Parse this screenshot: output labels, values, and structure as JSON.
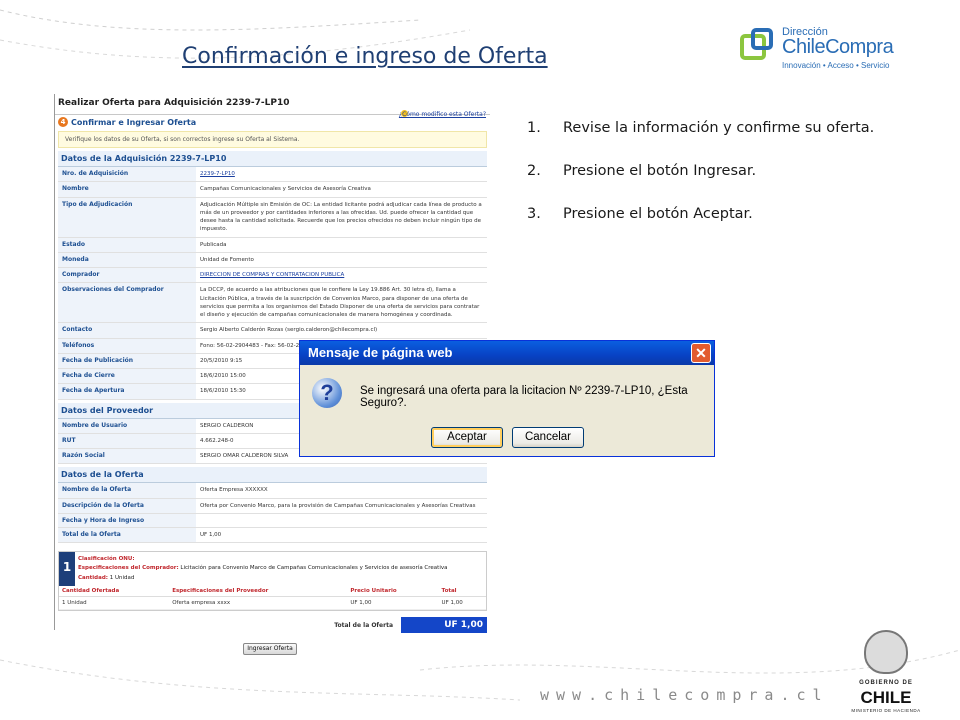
{
  "title": "Confirmación e ingreso de Oferta",
  "logo": {
    "dir": "Dirección",
    "name": "ChileCompra",
    "tagline": "Innovación • Acceso • Servicio"
  },
  "portal": {
    "header": "Realizar Oferta para Adquisición 2239-7-LP10",
    "help_link": "¿Cómo modifico esta Oferta?",
    "step_number": "4",
    "step_label": "Confirmar e Ingresar Oferta",
    "note": "Verifique los datos de su Oferta, si son correctos ingrese su Oferta al Sistema.",
    "sections": [
      {
        "title": "Datos de la Adquisición 2239-7-LP10",
        "rows": [
          {
            "k": "Nro. de Adquisición",
            "v": "2239-7-LP10",
            "link": true
          },
          {
            "k": "Nombre",
            "v": "Campañas Comunicacionales y Servicios de Asesoría Creativa"
          },
          {
            "k": "Tipo de Adjudicación",
            "v": "Adjudicación Múltiple sin Emisión de OC: La entidad licitante podrá adjudicar cada línea de producto a más de un proveedor y por cantidades inferiores a las ofrecidas. Ud. puede ofrecer la cantidad que desee hasta la cantidad solicitada. Recuerde que los precios ofrecidos no deben incluir ningún tipo de impuesto."
          },
          {
            "k": "Estado",
            "v": "Publicada"
          },
          {
            "k": "Moneda",
            "v": "Unidad de Fomento"
          },
          {
            "k": "Comprador",
            "v": "DIRECCION DE COMPRAS Y CONTRATACION PUBLICA",
            "link": true
          },
          {
            "k": "Observaciones del Comprador",
            "v": "La DCCP, de acuerdo a las atribuciones que le confiere la Ley 19.886 Art. 30 letra d), llama a Licitación Pública, a través de la suscripción de Convenios Marco, para disponer de una oferta de servicios que permita a los organismos del Estado Disponer de una oferta de servicios para contratar el diseño y ejecución de campañas comunicacionales de manera homogénea y coordinada."
          },
          {
            "k": "Contacto",
            "v": "Sergio Alberto Calderón Rozas (sergio.calderon@chilecompra.cl)"
          },
          {
            "k": "Teléfonos",
            "v": "Fono: 56-02-2904483 - Fax: 56-02-2904488"
          },
          {
            "k": "Fecha de Publicación",
            "v": "20/5/2010 9:15"
          },
          {
            "k": "Fecha de Cierre",
            "v": "18/6/2010 15:00"
          },
          {
            "k": "Fecha de Apertura",
            "v": "18/6/2010 15:30"
          }
        ]
      },
      {
        "title": "Datos del Proveedor",
        "rows": [
          {
            "k": "Nombre de Usuario",
            "v": "SERGIO CALDERON"
          },
          {
            "k": "RUT",
            "v": "4.662.248-0"
          },
          {
            "k": "Razón Social",
            "v": "SERGIO OMAR CALDERON SILVA"
          }
        ]
      },
      {
        "title": "Datos de la Oferta",
        "rows": [
          {
            "k": "Nombre de la Oferta",
            "v": "Oferta Empresa XXXXXX"
          },
          {
            "k": "Descripción de la Oferta",
            "v": "Oferta por Convenio Marco, para la provisión de Campañas Comunicacionales y Asesorías Creativas"
          },
          {
            "k": "Fecha y Hora de Ingreso",
            "v": ""
          },
          {
            "k": "Total de la Oferta",
            "v": "UF 1,00"
          }
        ]
      }
    ],
    "item": {
      "number": "1",
      "clasificacion_label": "Clasificación ONU:",
      "especificaciones_label": "Especificaciones del Comprador:",
      "especificaciones_value": "Licitación para Convenio Marco de Campañas Comunicacionales y Servicios de asesoría Creativa",
      "cantidad_label": "Cantidad:",
      "cantidad_value": "1 Unidad",
      "headers": [
        "Cantidad Ofertada",
        "Especificaciones del Proveedor",
        "Precio Unitario",
        "Total"
      ],
      "row": [
        "1 Unidad",
        "Oferta empresa xxxx",
        "UF 1,00",
        "UF 1,00"
      ]
    },
    "total_label": "Total de la Oferta",
    "total_value": "UF 1,00",
    "submit_button": "Ingresar Oferta"
  },
  "steps": [
    {
      "n": "1.",
      "t": "Revise la información y confirme su oferta."
    },
    {
      "n": "2.",
      "t": "Presione el botón Ingresar."
    },
    {
      "n": "3.",
      "t": "Presione el botón Aceptar."
    }
  ],
  "dialog": {
    "title": "Mensaje de página web",
    "close": "✕",
    "icon": "?",
    "message": "Se ingresará una oferta para la licitacion Nº 2239-7-LP10, ¿Esta Seguro?.",
    "ok": "Aceptar",
    "cancel": "Cancelar"
  },
  "footer": {
    "url": "www.chilecompra.cl",
    "gob": "GOBIERNO DE",
    "chile": "CHILE",
    "ministerio": "MINISTERIO DE HACIENDA"
  },
  "colors": {
    "title": "#1f3f73",
    "dialog_title": "#0842c4",
    "accent_blue": "#1446c8",
    "logo_green": "#8cc63f",
    "logo_blue": "#2a6db5"
  },
  "icons": [
    "help-icon",
    "step-number-icon",
    "question-icon",
    "close-icon",
    "gobierno-seal-icon"
  ]
}
